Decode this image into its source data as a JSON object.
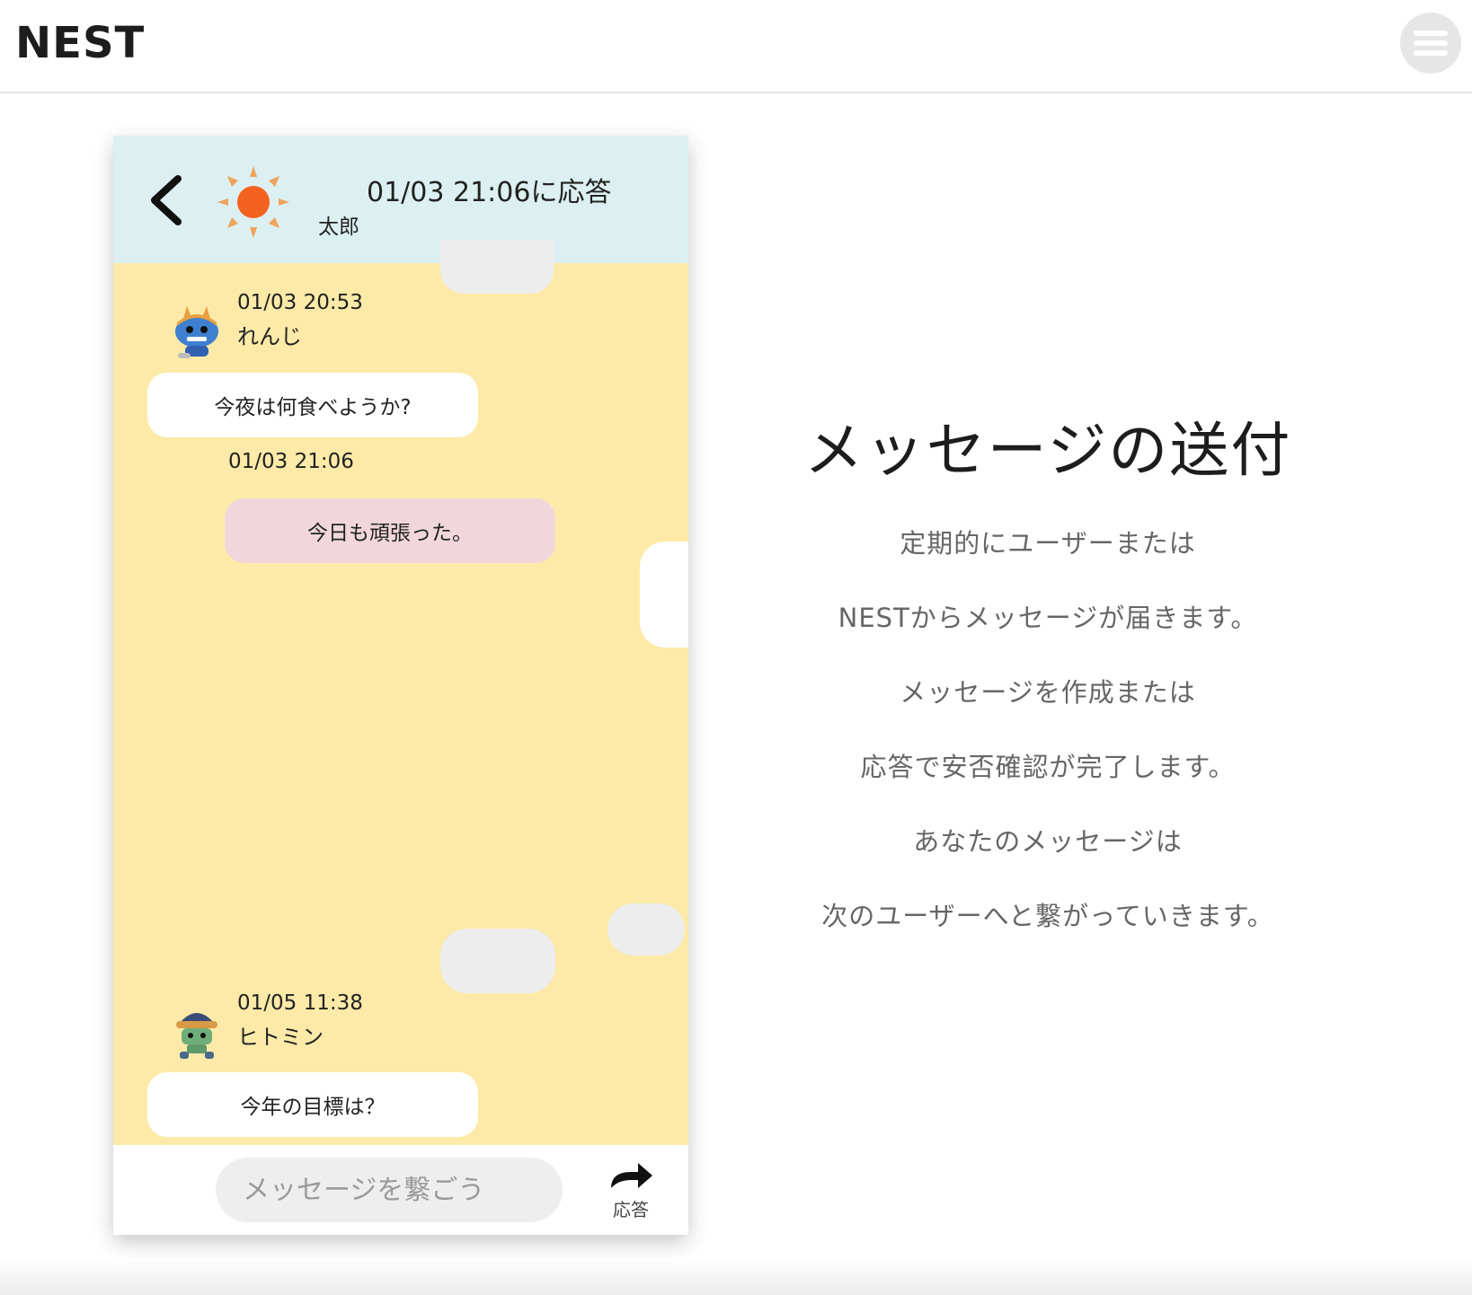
{
  "header": {
    "logo": "NEST",
    "menu_icon": "hamburger-icon"
  },
  "chat": {
    "header": {
      "back_icon": "chevron-left-icon",
      "avatar_icon": "sun-icon",
      "response_time": "01/03  21:06に応答",
      "user_name": "太郎"
    },
    "messages": [
      {
        "time": "01/03  20:53",
        "user": "れんじ",
        "text": "今夜は何食べようか?",
        "avatar_icon": "oni-character-icon",
        "kind": "received"
      },
      {
        "time": "01/03  21:06",
        "text": "今日も頑張った。",
        "kind": "sent"
      },
      {
        "time": "01/05  11:38",
        "user": "ヒトミン",
        "text": "今年の目標は？",
        "avatar_icon": "robot-character-icon",
        "kind": "received"
      }
    ],
    "input": {
      "placeholder": "メッセージを繋ごう",
      "reply_label": "応答",
      "reply_icon": "reply-arrow-icon"
    }
  },
  "feature": {
    "title": "メッセージの送付",
    "lines": [
      "定期的にユーザーまたは",
      "NESTからメッセージが届きます。",
      "メッセージを作成または",
      "応答で安否確認が完了します。",
      "あなたのメッセージは",
      "次のユーザーへと繋がっていきます。"
    ]
  },
  "colors": {
    "chat_background": "#fdeaa8",
    "chat_header": "#dcf0f1",
    "sent_bubble": "#f1d7db",
    "sun": "#f4621f"
  }
}
